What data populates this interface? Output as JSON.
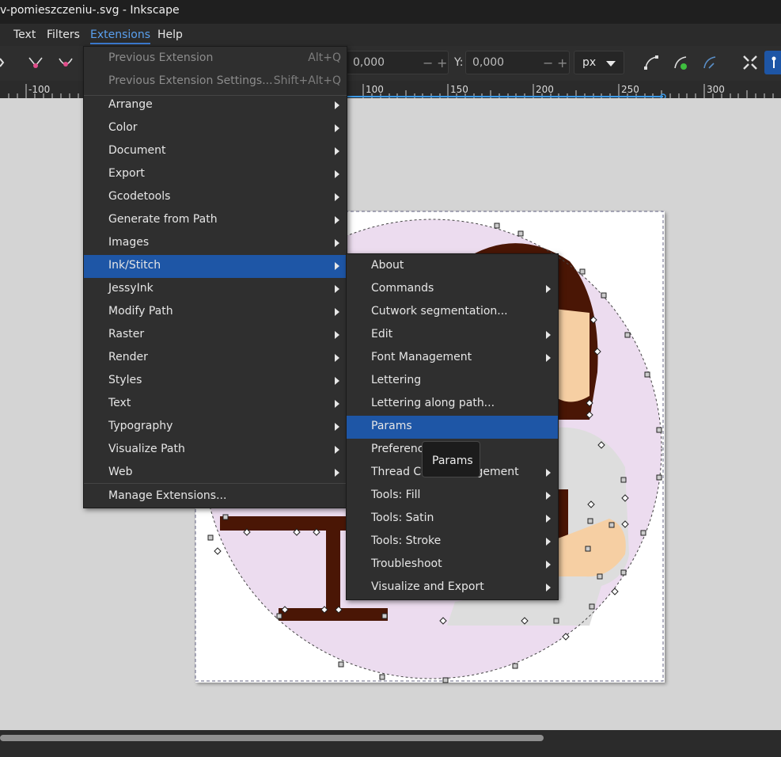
{
  "window": {
    "title": "v-pomieszczeniu-.svg - Inkscape"
  },
  "menubar": {
    "items": [
      "Text",
      "Filters",
      "Extensions",
      "Help"
    ],
    "active": "Extensions"
  },
  "toolbar": {
    "x_value": "0,000",
    "y_label": "Y:",
    "y_value": "0,000",
    "minus": "−",
    "plus": "+",
    "unit": "px"
  },
  "ruler": {
    "labels": [
      "-100",
      "100",
      "150",
      "200",
      "250",
      "300"
    ]
  },
  "extensions_menu": {
    "items": [
      {
        "label": "Previous Extension",
        "shortcut": "Alt+Q",
        "disabled": true
      },
      {
        "label": "Previous Extension Settings...",
        "shortcut": "Shift+Alt+Q",
        "disabled": true
      },
      {
        "label": "Arrange",
        "submenu": true
      },
      {
        "label": "Color",
        "submenu": true
      },
      {
        "label": "Document",
        "submenu": true
      },
      {
        "label": "Export",
        "submenu": true
      },
      {
        "label": "Gcodetools",
        "submenu": true
      },
      {
        "label": "Generate from Path",
        "submenu": true
      },
      {
        "label": "Images",
        "submenu": true
      },
      {
        "label": "Ink/Stitch",
        "submenu": true,
        "highlighted": true
      },
      {
        "label": "JessyInk",
        "submenu": true
      },
      {
        "label": "Modify Path",
        "submenu": true
      },
      {
        "label": "Raster",
        "submenu": true
      },
      {
        "label": "Render",
        "submenu": true
      },
      {
        "label": "Styles",
        "submenu": true
      },
      {
        "label": "Text",
        "submenu": true
      },
      {
        "label": "Typography",
        "submenu": true
      },
      {
        "label": "Visualize Path",
        "submenu": true
      },
      {
        "label": "Web",
        "submenu": true
      },
      {
        "label": "Manage Extensions..."
      }
    ]
  },
  "inkstitch_menu": {
    "items": [
      {
        "label": "About"
      },
      {
        "label": "Commands",
        "submenu": true
      },
      {
        "label": "Cutwork segmentation..."
      },
      {
        "label": "Edit",
        "submenu": true
      },
      {
        "label": "Font Management",
        "submenu": true
      },
      {
        "label": "Lettering"
      },
      {
        "label": "Lettering along path..."
      },
      {
        "label": "Params",
        "highlighted": true
      },
      {
        "label": "Preferences"
      },
      {
        "label": "Thread Color Management",
        "submenu": true
      },
      {
        "label": "Tools: Fill",
        "submenu": true
      },
      {
        "label": "Tools: Satin",
        "submenu": true
      },
      {
        "label": "Tools: Stroke",
        "submenu": true
      },
      {
        "label": "Troubleshoot",
        "submenu": true
      },
      {
        "label": "Visualize and Export",
        "submenu": true
      }
    ]
  },
  "tooltip": {
    "text": "Params"
  },
  "colors": {
    "highlight": "#1e56a6",
    "accent": "#3b7ad0",
    "artwork_hair": "#4a1605",
    "artwork_skin": "#f6cfa3",
    "artwork_circle": "#ecdcef",
    "artwork_shirt": "#dddddd"
  }
}
